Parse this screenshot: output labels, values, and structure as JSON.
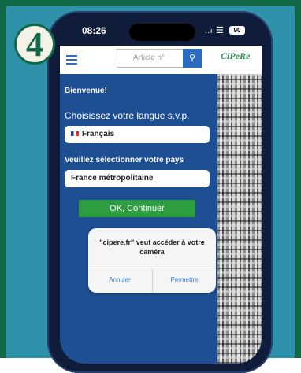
{
  "step": {
    "number": "4"
  },
  "status_bar": {
    "time": "08:26",
    "signal": "..ıl",
    "wifi_icon": "wifi-icon",
    "battery": "90"
  },
  "header": {
    "search": {
      "placeholder": "Article n°"
    },
    "logo_text": "CiPeRe",
    "icons": {
      "menu": "hamburger-icon",
      "search": "search-icon"
    }
  },
  "menu": {
    "welcome": "Bienvenue!",
    "language_label": "Choisissez votre langue s.v.p.",
    "language_value": "Français",
    "country_label": "Veuillez sélectionner votre pays",
    "country_value": "France métropolitaine",
    "ok_label": "OK, Continuer"
  },
  "dialog": {
    "message": "\"cipere.fr\" veut accéder à votre caméra",
    "cancel_label": "Annuler",
    "allow_label": "Permettre"
  },
  "colors": {
    "outer_bg": "#11694a",
    "panel_bg": "#2e92aa",
    "menu_bg": "#1e4f92",
    "ok_green": "#2f9d42",
    "dialog_link": "#3d7bd8"
  }
}
